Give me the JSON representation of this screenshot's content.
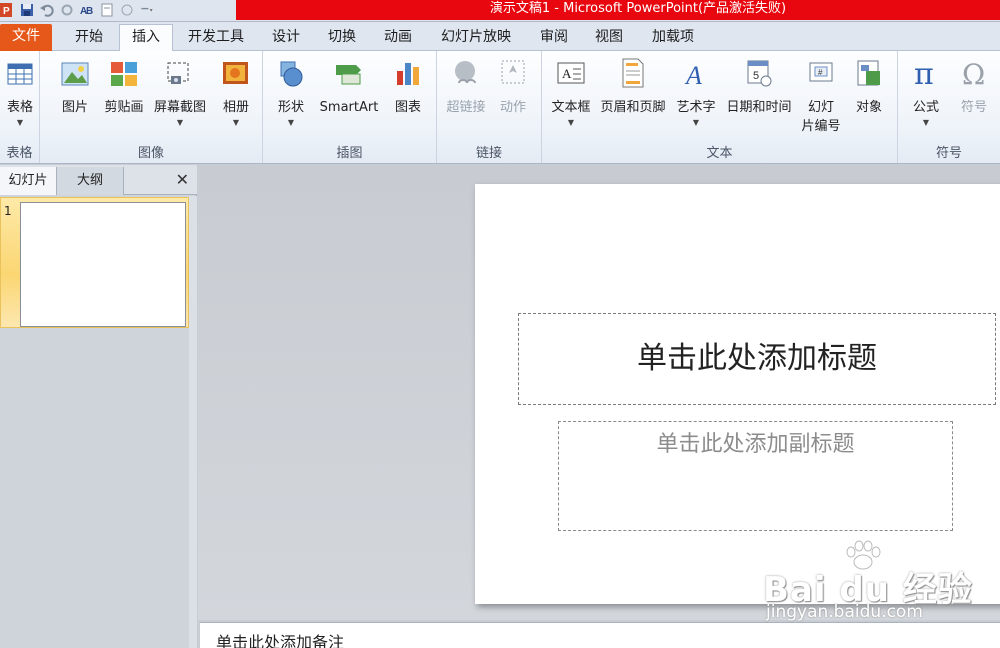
{
  "window": {
    "title": "演示文稿1 - Microsoft PowerPoint(产品激活失败)"
  },
  "quick_access": {
    "icons": [
      "powerpoint-logo-icon",
      "save-icon",
      "undo-icon",
      "redo-icon",
      "spelling-icon",
      "print-preview-icon",
      "dropdown-icon"
    ]
  },
  "ribbon_tabs": [
    {
      "label": "文件"
    },
    {
      "label": "开始"
    },
    {
      "label": "插入"
    },
    {
      "label": "开发工具"
    },
    {
      "label": "设计"
    },
    {
      "label": "切换"
    },
    {
      "label": "动画"
    },
    {
      "label": "幻灯片放映"
    },
    {
      "label": "审阅"
    },
    {
      "label": "视图"
    },
    {
      "label": "加载项"
    }
  ],
  "active_tab": "插入",
  "groups": {
    "table": {
      "name": "表格",
      "buttons": [
        {
          "label": "表格"
        }
      ]
    },
    "images": {
      "name": "图像",
      "buttons": [
        {
          "label": "图片"
        },
        {
          "label": "剪贴画"
        },
        {
          "label": "屏幕截图"
        },
        {
          "label": "相册"
        }
      ]
    },
    "illustrations": {
      "name": "插图",
      "buttons": [
        {
          "label": "形状"
        },
        {
          "label": "SmartArt"
        },
        {
          "label": "图表"
        }
      ]
    },
    "links": {
      "name": "链接",
      "buttons": [
        {
          "label": "超链接"
        },
        {
          "label": "动作"
        }
      ]
    },
    "text": {
      "name": "文本",
      "buttons": [
        {
          "label": "文本框"
        },
        {
          "label": "页眉和页脚"
        },
        {
          "label": "艺术字"
        },
        {
          "label": "日期和时间"
        },
        {
          "label": "幻灯",
          "label2": "片编号"
        },
        {
          "label": "对象"
        }
      ]
    },
    "symbols": {
      "name": "符号",
      "buttons": [
        {
          "label": "公式"
        },
        {
          "label": "符号"
        }
      ]
    }
  },
  "left_panel": {
    "tab_slides": "幻灯片",
    "tab_outline": "大纲",
    "close": "✕",
    "slide_number": "1"
  },
  "slide": {
    "title_placeholder": "单击此处添加标题",
    "subtitle_placeholder": "单击此处添加副标题"
  },
  "notes": {
    "placeholder": "单击此处添加备注"
  },
  "watermark": {
    "brand": "Bai du 经验",
    "url": "jingyan.baidu.com"
  },
  "colors": {
    "title_bar_accent": "#e8070f",
    "file_tab": "#e5581a",
    "slide_selection": "#fbd672"
  }
}
